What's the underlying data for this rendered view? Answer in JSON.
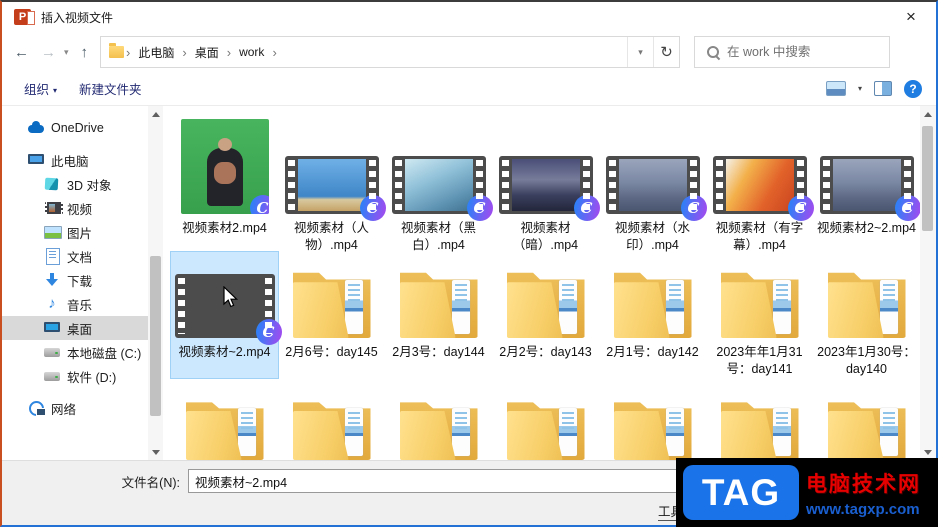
{
  "window": {
    "title": "插入视频文件",
    "close_label": "×"
  },
  "address_bar": {
    "back_icon": "←",
    "forward_icon": "→",
    "up_icon": "↑",
    "dropdown_icon": "▾",
    "refresh_icon": "↻",
    "breadcrumb": [
      "此电脑",
      "桌面",
      "work"
    ],
    "search_placeholder": "在 work 中搜索"
  },
  "toolbar": {
    "organize_label": "组织",
    "new_folder_label": "新建文件夹",
    "help_label": "?"
  },
  "sidebar": {
    "items": [
      {
        "id": "onedrive",
        "label": "OneDrive",
        "icon": "cloud",
        "indent": 0,
        "selected": false,
        "gap": true
      },
      {
        "id": "this-pc",
        "label": "此电脑",
        "icon": "pc",
        "indent": 0,
        "selected": false,
        "gap": false
      },
      {
        "id": "3d-objects",
        "label": "3D 对象",
        "icon": "cube",
        "indent": 1,
        "selected": false,
        "gap": false
      },
      {
        "id": "videos",
        "label": "视频",
        "icon": "film",
        "indent": 1,
        "selected": false,
        "gap": false
      },
      {
        "id": "pictures",
        "label": "图片",
        "icon": "picture",
        "indent": 1,
        "selected": false,
        "gap": false
      },
      {
        "id": "documents",
        "label": "文档",
        "icon": "doc",
        "indent": 1,
        "selected": false,
        "gap": false
      },
      {
        "id": "downloads",
        "label": "下载",
        "icon": "download",
        "indent": 1,
        "selected": false,
        "gap": false
      },
      {
        "id": "music",
        "label": "音乐",
        "icon": "music",
        "indent": 1,
        "selected": false,
        "gap": false
      },
      {
        "id": "desktop",
        "label": "桌面",
        "icon": "desktop",
        "indent": 1,
        "selected": true,
        "gap": false
      },
      {
        "id": "local-disk-c",
        "label": "本地磁盘 (C:)",
        "icon": "disk",
        "indent": 1,
        "selected": false,
        "gap": false
      },
      {
        "id": "software-d",
        "label": "软件 (D:)",
        "icon": "disk",
        "indent": 1,
        "selected": false,
        "gap": true
      },
      {
        "id": "network",
        "label": "网络",
        "icon": "network",
        "indent": 0,
        "selected": false,
        "gap": false
      }
    ]
  },
  "files": {
    "badge_label": "C",
    "row1": [
      {
        "label": "视频素材2.mp4",
        "type": "video",
        "thumb": "green-portrait",
        "selected": false
      },
      {
        "label": "视频素材（人物）.mp4",
        "type": "video",
        "thumb": "sky",
        "selected": false
      },
      {
        "label": "视频素材（黑白）.mp4",
        "type": "video",
        "thumb": "ice",
        "selected": false
      },
      {
        "label": "视频素材（暗）.mp4",
        "type": "video",
        "thumb": "darkcity",
        "selected": false
      },
      {
        "label": "视频素材（水印）.mp4",
        "type": "video",
        "thumb": "city",
        "selected": false
      },
      {
        "label": "视频素材（有字幕）.mp4",
        "type": "video",
        "thumb": "autumn",
        "selected": false
      },
      {
        "label": "视频素材2~2.mp4",
        "type": "video",
        "thumb": "city",
        "selected": false
      }
    ],
    "row2": [
      {
        "label": "视频素材~2.mp4",
        "type": "video",
        "thumb": "autumnleaf",
        "selected": true
      },
      {
        "label": "2月6号：day145",
        "type": "folder",
        "selected": false
      },
      {
        "label": "2月3号：day144",
        "type": "folder",
        "selected": false
      },
      {
        "label": "2月2号：day143",
        "type": "folder",
        "selected": false
      },
      {
        "label": "2月1号：day142",
        "type": "folder",
        "selected": false
      },
      {
        "label": "2023年年1月31号：day141",
        "type": "folder",
        "selected": false
      },
      {
        "label": "2023年1月30号：day140",
        "type": "folder",
        "selected": false
      }
    ],
    "row3_partial_count": 7
  },
  "footer": {
    "filename_label": "文件名(N):",
    "filename_value": "视频素材~2.mp4",
    "tools_label": "工具"
  },
  "watermark": {
    "tag_text": "TAG",
    "site_name": "电脑技术网",
    "site_url": "www.tagxp.com"
  },
  "colors": {
    "selection_bg": "#cce8ff",
    "selection_border": "#9fd1f7",
    "folder_yellow": "#f8d06b",
    "badge_start": "#2f7ff7",
    "badge_end": "#9b4ef0",
    "watermark_bg": "#000000",
    "watermark_tag_bg": "#1a73e8",
    "watermark_site_red": "#e60000",
    "watermark_url_blue": "#1a5fd0",
    "command_text_blue": "#222a72"
  }
}
